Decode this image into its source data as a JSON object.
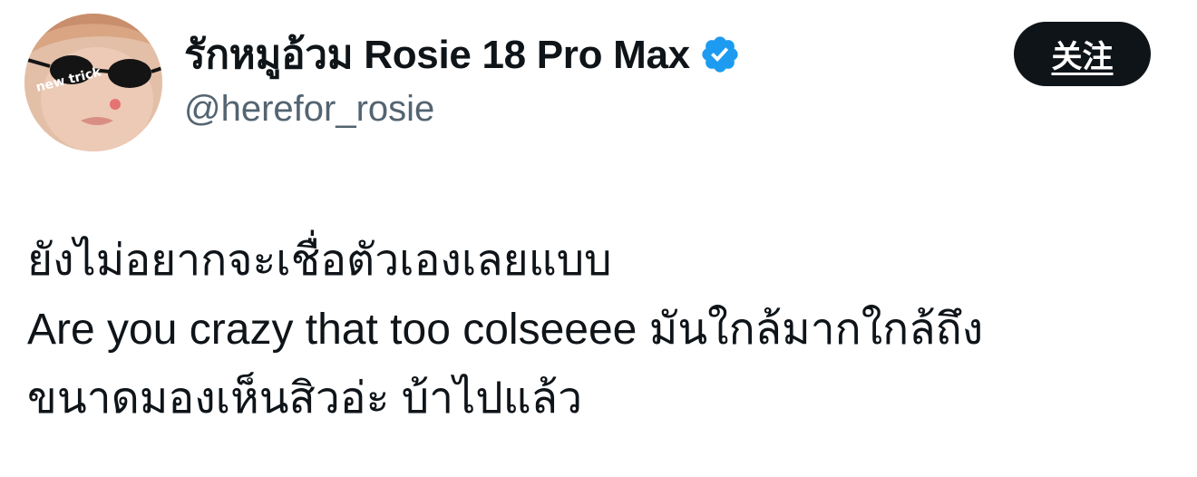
{
  "author": {
    "display_name": "รักหมูอ้วม Rosie 18 Pro Max",
    "handle": "@herefor_rosie",
    "verified": true,
    "avatar_sticker_text": "new trick"
  },
  "follow_button": {
    "label": "关注"
  },
  "tweet": {
    "lines": [
      "ยังไม่อยากจะเชื่อตัวเองเลยแบบ",
      "Are you crazy that too colseeee มันใกล้มากใกล้ถึง",
      "ขนาดมองเห็นสิวอ่ะ บ้าไปแล้ว"
    ]
  },
  "colors": {
    "text": "#0f1419",
    "secondary_text": "#536471",
    "verified_badge": "#1d9bf0",
    "button_bg": "#0f1419",
    "button_text": "#ffffff"
  },
  "icons": {
    "verified": "verified-badge-icon"
  }
}
